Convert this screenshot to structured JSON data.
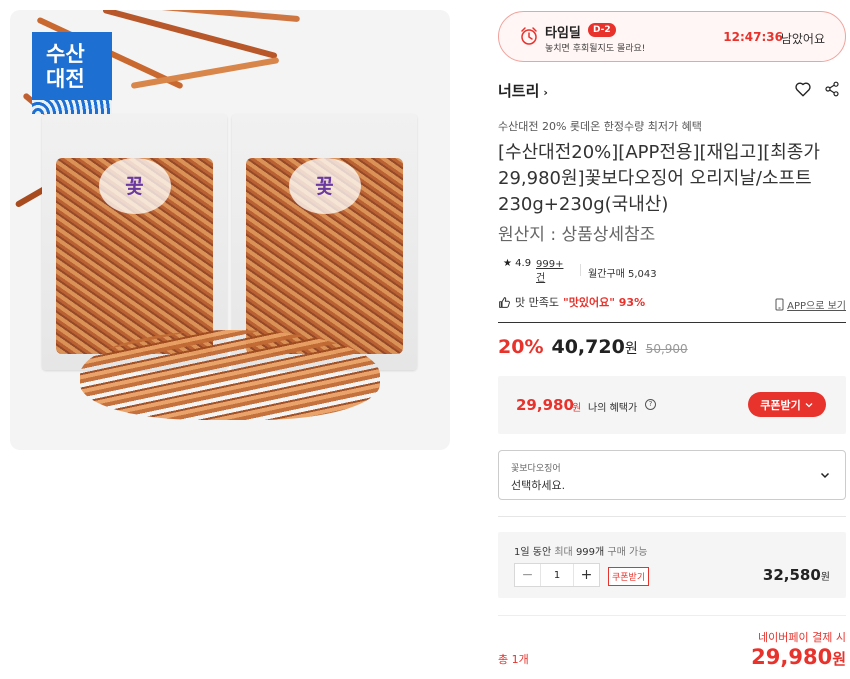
{
  "colors": {
    "accent": "#e8322c",
    "event_badge": "#1d6fd1"
  },
  "event_badge": {
    "line1": "수산",
    "line2": "대전"
  },
  "timedeal": {
    "title": "타임딜",
    "dday": "D-2",
    "subtitle": "놓치면 후회될지도 몰라요!",
    "countdown": "12:47:36",
    "remain_label": "남았어요"
  },
  "brand": {
    "name": "너트리",
    "chevron": "›"
  },
  "promo_text": "수산대전 20% 롯데온 한정수량 최저가 혜택",
  "product_title": "[수산대전20%][APP전용][재입고][최종가29,980원]꽃보다오징어 오리지날/소프트 230g+230g(국내산)",
  "origin": "원산지 : 상품상세참조",
  "rating": {
    "star": "★",
    "score": "4.9",
    "review_count": "999+ 건",
    "monthly_label": "월간구매 5,043"
  },
  "taste": {
    "label": "맛 만족도",
    "highlight": "\"맛있어요\" 93%"
  },
  "app_link": "APP으로 보기",
  "price": {
    "discount": "20%",
    "sale": "40,720",
    "unit": "원",
    "original": "50,900"
  },
  "benefit": {
    "price": "29,980",
    "unit": "원",
    "label": "나의 혜택가",
    "info": "?",
    "coupon_button": "쿠폰받기"
  },
  "option": {
    "label": "꽃보다오징어",
    "placeholder": "선택하세요."
  },
  "quantity": {
    "limit_prefix": "1일 동안",
    "limit_mid": "최대",
    "limit_count": "999개",
    "limit_suffix": "구매 가능",
    "minus": "−",
    "value": "1",
    "plus": "+",
    "coupon_tag": "쿠폰받기",
    "price": "32,580",
    "unit": "원"
  },
  "summary": {
    "npay_note": "네이버페이 결제 시",
    "total_count": "총 1개",
    "total": "29,980",
    "unit": "원"
  },
  "icons": [
    "clock-icon",
    "heart-icon",
    "share-icon",
    "thumbs-up-icon",
    "phone-icon",
    "chevron-down-icon",
    "info-icon"
  ]
}
